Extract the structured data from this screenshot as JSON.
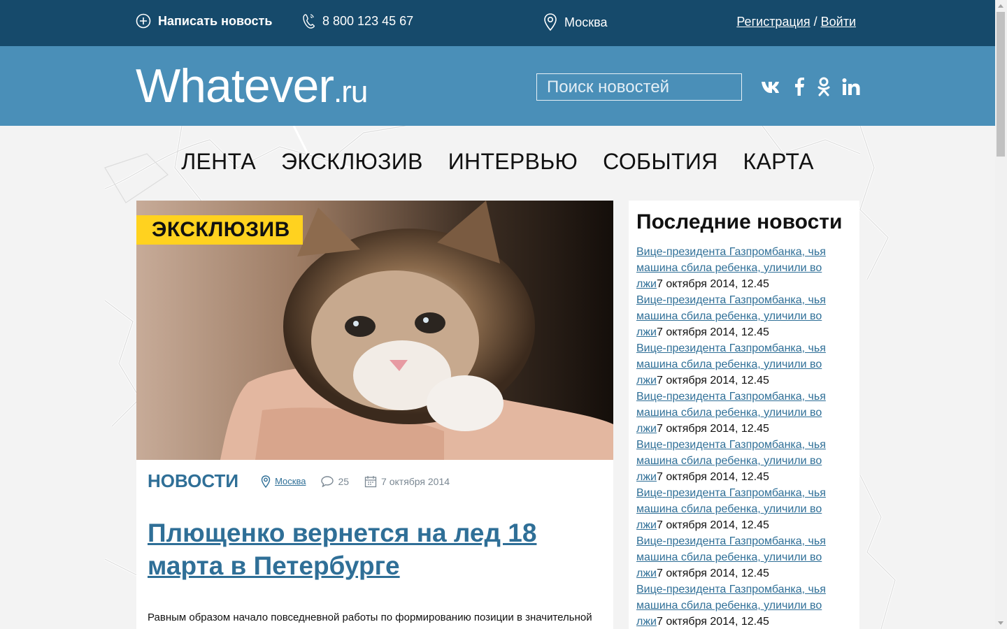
{
  "topbar": {
    "write_news": "Написать новость",
    "phone": "8 800 123 45 67",
    "city": "Москва",
    "register": "Регистрация",
    "separator": "/",
    "login": "Войти"
  },
  "header": {
    "logo_main": "Whatever",
    "logo_tld": ".ru",
    "search_placeholder": "Поиск новостей",
    "social": [
      "vk-icon",
      "facebook-icon",
      "odnoklassniki-icon",
      "linkedin-icon"
    ]
  },
  "nav": {
    "items": [
      {
        "label": "ЛЕНТА"
      },
      {
        "label": "ЭКСКЛЮЗИВ"
      },
      {
        "label": "ИНТЕРВЬЮ"
      },
      {
        "label": "СОБЫТИЯ"
      },
      {
        "label": "КАРТА"
      }
    ]
  },
  "article": {
    "badge": "ЭКСКЛЮЗИВ",
    "category": "НОВОСТИ",
    "city": "Москва",
    "comments": "25",
    "date": "7 октября 2014",
    "title": "Плющенко вернется на лед 18 марта в Петербурге",
    "lead": "Равным образом начало повседневной работы по формированию позиции в значительной"
  },
  "sidebar": {
    "title": "Последние новости",
    "items": [
      {
        "link": "Вице-президента Газпромбанка, чья машина сбила ребенка, уличили во лжи",
        "date": "7 октября 2014, 12.45"
      },
      {
        "link": "Вице-президента Газпромбанка, чья машина сбила ребенка, уличили во лжи",
        "date": "7 октября 2014, 12.45"
      },
      {
        "link": "Вице-президента Газпромбанка, чья машина сбила ребенка, уличили во лжи",
        "date": "7 октября 2014, 12.45"
      },
      {
        "link": "Вице-президента Газпромбанка, чья машина сбила ребенка, уличили во лжи",
        "date": "7 октября 2014, 12.45"
      },
      {
        "link": "Вице-президента Газпромбанка, чья машина сбила ребенка, уличили во лжи",
        "date": "7 октября 2014, 12.45"
      },
      {
        "link": "Вице-президента Газпромбанка, чья машина сбила ребенка, уличили во лжи",
        "date": "7 октября 2014, 12.45"
      },
      {
        "link": "Вице-президента Газпромбанка, чья машина сбила ребенка, уличили во лжи",
        "date": "7 октября 2014, 12.45"
      },
      {
        "link": "Вице-президента Газпромбанка, чья машина сбила ребенка, уличили во лжи",
        "date": "7 октября 2014, 12.45"
      }
    ]
  },
  "colors": {
    "topbar": "#164a6b",
    "header": "#4a8fb8",
    "accent_link": "#2f6f97",
    "badge": "#ffd21f"
  }
}
